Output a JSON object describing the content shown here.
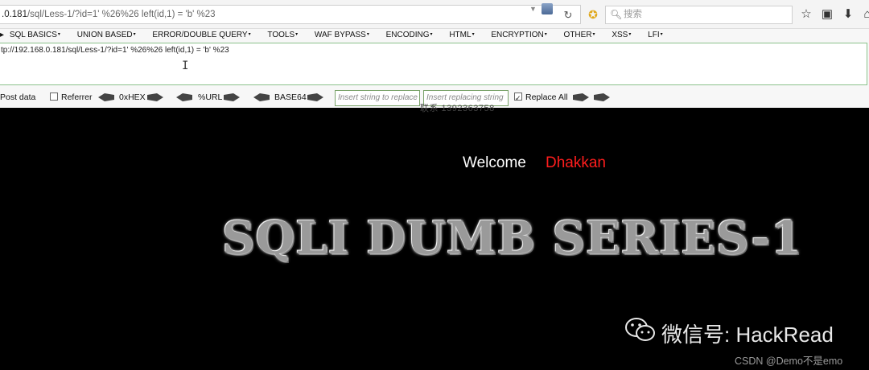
{
  "browser": {
    "url_host": ".0.181",
    "url_rest": "/sql/Less-1/?id=1' %26%26 left(id,1) = 'b' %23",
    "search_placeholder": "搜索"
  },
  "hackbar": {
    "menu": [
      "SQL BASICS",
      "UNION BASED",
      "ERROR/DOUBLE QUERY",
      "TOOLS",
      "WAF BYPASS",
      "ENCODING",
      "HTML",
      "ENCRYPTION",
      "OTHER",
      "XSS",
      "LFI"
    ],
    "url_text": "tp://192.168.0.181/sql/Less-1/?id=1' %26%26 left(id,1) = 'b' %23",
    "post_data_label": "Post data",
    "referrer_label": "Referrer",
    "hex_label": "0xHEX",
    "url_label": "%URL",
    "base64_label": "BASE64",
    "replace_placeholder": "Insert string to replace",
    "replacing_placeholder": "Insert replacing string",
    "replace_all_label": "Replace All",
    "replace_all_checked": true
  },
  "page": {
    "welcome_text": "Welcome",
    "username": "Dhakkan",
    "banner": "SQLI DUMB SERIES-1",
    "ghost_text": "联系 1392363758"
  },
  "watermark": {
    "wechat": "微信号: HackRead",
    "csdn": "CSDN @Demo不是emo"
  },
  "colors": {
    "username": "#ff1d1d",
    "background": "#000000",
    "bookmark_star": "#e0a81c"
  }
}
